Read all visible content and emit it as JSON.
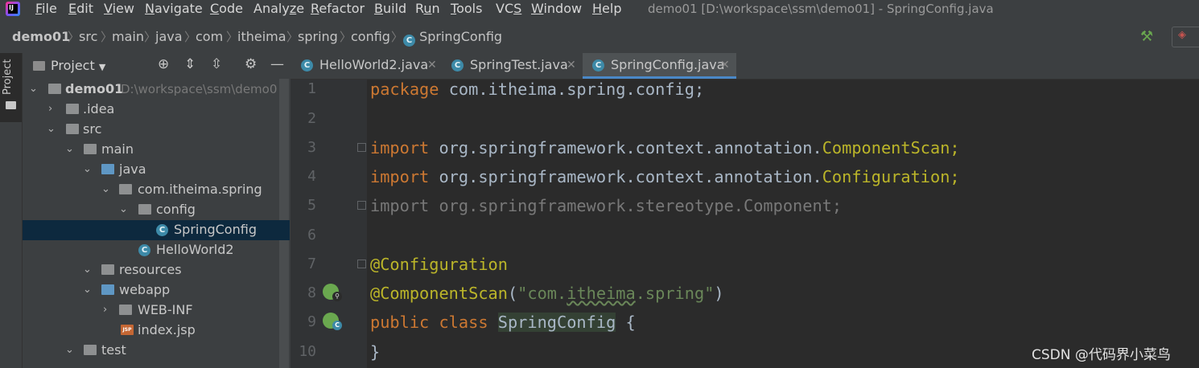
{
  "menubar": {
    "items": [
      {
        "label": "File",
        "mnemonic": "F"
      },
      {
        "label": "Edit",
        "mnemonic": "E"
      },
      {
        "label": "View",
        "mnemonic": "V"
      },
      {
        "label": "Navigate",
        "mnemonic": "N"
      },
      {
        "label": "Code",
        "mnemonic": "C"
      },
      {
        "label": "Analyze",
        "mnemonic": "z"
      },
      {
        "label": "Refactor",
        "mnemonic": "R"
      },
      {
        "label": "Build",
        "mnemonic": "B"
      },
      {
        "label": "Run",
        "mnemonic": "u"
      },
      {
        "label": "Tools",
        "mnemonic": "T"
      },
      {
        "label": "VCS",
        "mnemonic": "S"
      },
      {
        "label": "Window",
        "mnemonic": "W"
      },
      {
        "label": "Help",
        "mnemonic": "H"
      }
    ],
    "window_title": "demo01 [D:\\workspace\\ssm\\demo01] - SpringConfig.java"
  },
  "breadcrumbs": [
    "demo01",
    "src",
    "main",
    "java",
    "com",
    "itheima",
    "spring",
    "config",
    "SpringConfig"
  ],
  "stripe": {
    "project_label": "Project"
  },
  "project": {
    "title": "Project",
    "tree": [
      {
        "label": "demo01",
        "path": "D:\\workspace\\ssm\\demo0"
      },
      {
        "label": ".idea"
      },
      {
        "label": "src"
      },
      {
        "label": "main"
      },
      {
        "label": "java"
      },
      {
        "label": "com.itheima.spring"
      },
      {
        "label": "config"
      },
      {
        "label": "SpringConfig"
      },
      {
        "label": "HelloWorld2"
      },
      {
        "label": "resources"
      },
      {
        "label": "webapp"
      },
      {
        "label": "WEB-INF"
      },
      {
        "label": "index.jsp"
      },
      {
        "label": "test"
      }
    ]
  },
  "tabs": [
    {
      "label": "HelloWorld2.java",
      "active": false
    },
    {
      "label": "SpringTest.java",
      "active": false
    },
    {
      "label": "SpringConfig.java",
      "active": true
    }
  ],
  "editor": {
    "line_numbers": [
      "1",
      "2",
      "3",
      "4",
      "5",
      "6",
      "7",
      "8",
      "9",
      "10"
    ],
    "code": {
      "l1_kw": "package",
      "l1_rest": " com.itheima.spring.config;",
      "l3_kw": "import",
      "l3_pkg": " org.springframework.context.annotation.",
      "l3_cls": "ComponentScan;",
      "l4_kw": "import",
      "l4_pkg": " org.springframework.context.annotation.",
      "l4_cls": "Configuration;",
      "l5": "import org.springframework.stereotype.Component;",
      "l7": "@Configuration",
      "l8_ann": "@ComponentScan",
      "l8_open": "(",
      "l8_str_a": "\"com.",
      "l8_str_b": "itheima",
      "l8_str_c": ".spring\"",
      "l8_close": ")",
      "l9_kw": "public class",
      "l9_cls": "SpringConfig",
      "l9_brace": " {",
      "l10": "}"
    }
  },
  "watermark": "CSDN @代码界小菜鸟",
  "colors": {
    "keyword": "#cc7832",
    "annotation": "#bbb529",
    "string": "#6a8759",
    "selection": "#0d293e",
    "active_tab_underline": "#4a88c7"
  }
}
